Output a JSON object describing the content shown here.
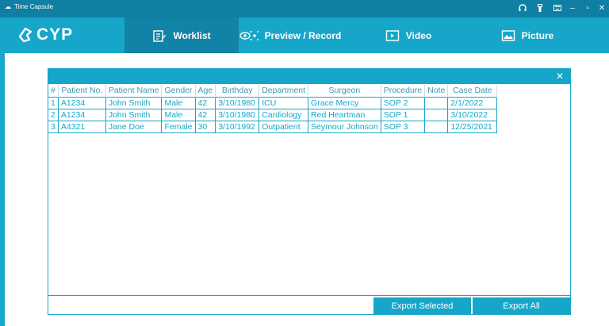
{
  "window": {
    "title": "Time Capsule",
    "controls": [
      "headset-icon",
      "usb-icon",
      "keyboard-icon",
      "minimize-icon",
      "maximize-icon",
      "close-icon"
    ]
  },
  "brand": {
    "name": "CYP"
  },
  "nav": {
    "tabs": [
      {
        "label": "Worklist",
        "icon": "worklist-icon",
        "active": true
      },
      {
        "label": "Preview / Record",
        "icon": "eye-icon",
        "active": false
      },
      {
        "label": "Video",
        "icon": "video-icon",
        "active": false
      },
      {
        "label": "Picture",
        "icon": "picture-icon",
        "active": false
      }
    ]
  },
  "worklist": {
    "columns": [
      "#",
      "Patient No.",
      "Patient Name",
      "Gender",
      "Age",
      "Birthday",
      "Department",
      "Surgeon",
      "Procedure",
      "Note",
      "Case Date"
    ],
    "rows": [
      [
        "1",
        "A1234",
        "John Smith",
        "Male",
        "42",
        "3/10/1980",
        "ICU",
        "Grace Mercy",
        "SOP 2",
        "",
        "2/1/2022"
      ],
      [
        "2",
        "A1234",
        "John Smith",
        "Male",
        "42",
        "3/10/1980",
        "Cardiology",
        "Red Heartman",
        "SOP 1",
        "",
        "3/10/2022"
      ],
      [
        "3",
        "A4321",
        "Jane Doe",
        "Female",
        "30",
        "3/10/1992",
        "Outpatient",
        "Seymour Johnson",
        "SOP 3",
        "",
        "12/25/2021"
      ]
    ],
    "export_selected": "Export Selected",
    "export_all": "Export All"
  },
  "colors": {
    "primary": "#16a6c9",
    "titlebar": "#0f7fa3",
    "active_tab": "#1183a6"
  }
}
